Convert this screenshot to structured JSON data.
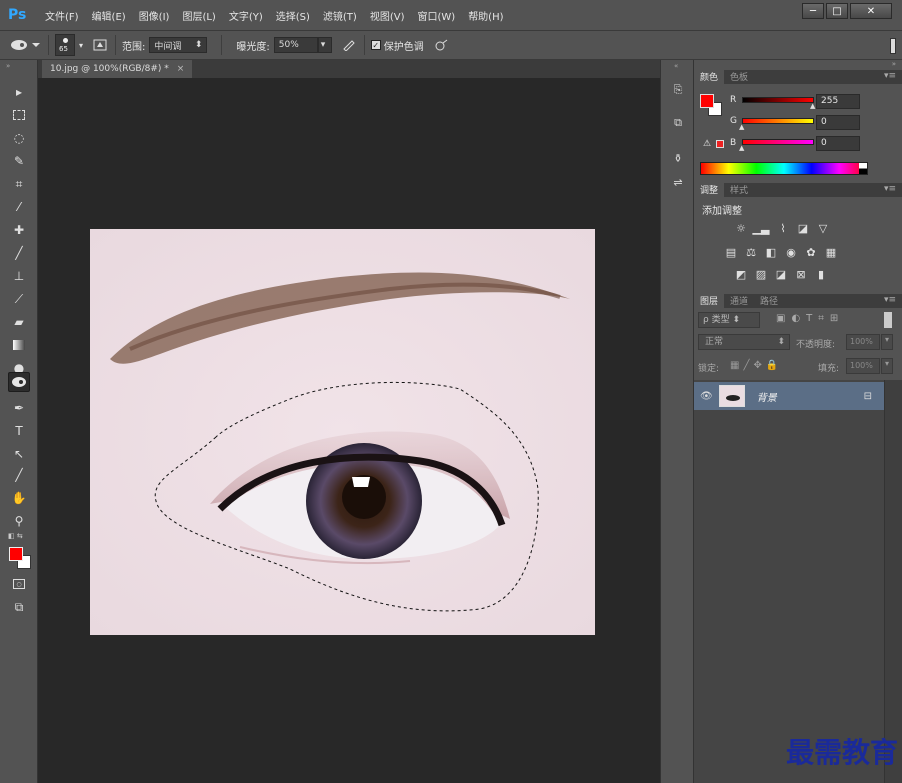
{
  "app": {
    "logo": "Ps"
  },
  "menu": [
    "文件(F)",
    "编辑(E)",
    "图像(I)",
    "图层(L)",
    "文字(Y)",
    "选择(S)",
    "滤镜(T)",
    "视图(V)",
    "窗口(W)",
    "帮助(H)"
  ],
  "window_controls": {
    "minimize": "─",
    "maximize": "□",
    "close": "✕"
  },
  "options": {
    "brush_size": "65",
    "range_label": "范围:",
    "range_value": "中间调",
    "exposure_label": "曝光度:",
    "exposure_value": "50%",
    "protect_tones_label": "保护色调",
    "protect_tones_checked": true
  },
  "document": {
    "tab_title": "10.jpg @ 100%(RGB/8#) *",
    "close": "×"
  },
  "color_panel": {
    "tabs": [
      "颜色",
      "色板"
    ],
    "active_tab": "颜色",
    "foreground": "#ff0000",
    "background": "#ffffff",
    "r_label": "R",
    "r_value": "255",
    "g_label": "G",
    "g_value": "0",
    "b_label": "B",
    "b_value": "0"
  },
  "adjustments_panel": {
    "tabs": [
      "调整",
      "样式"
    ],
    "active_tab": "调整",
    "title": "添加调整"
  },
  "layers_panel": {
    "tabs": [
      "图层",
      "通道",
      "路径"
    ],
    "active_tab": "图层",
    "filter_label": "ρ 类型",
    "blend_mode": "正常",
    "opacity_label": "不透明度:",
    "opacity_value": "100%",
    "lock_label": "锁定:",
    "fill_label": "填充:",
    "fill_value": "100%",
    "layers": [
      {
        "name": "背景",
        "visible": true,
        "locked": true
      }
    ]
  },
  "watermark": "最需教育"
}
